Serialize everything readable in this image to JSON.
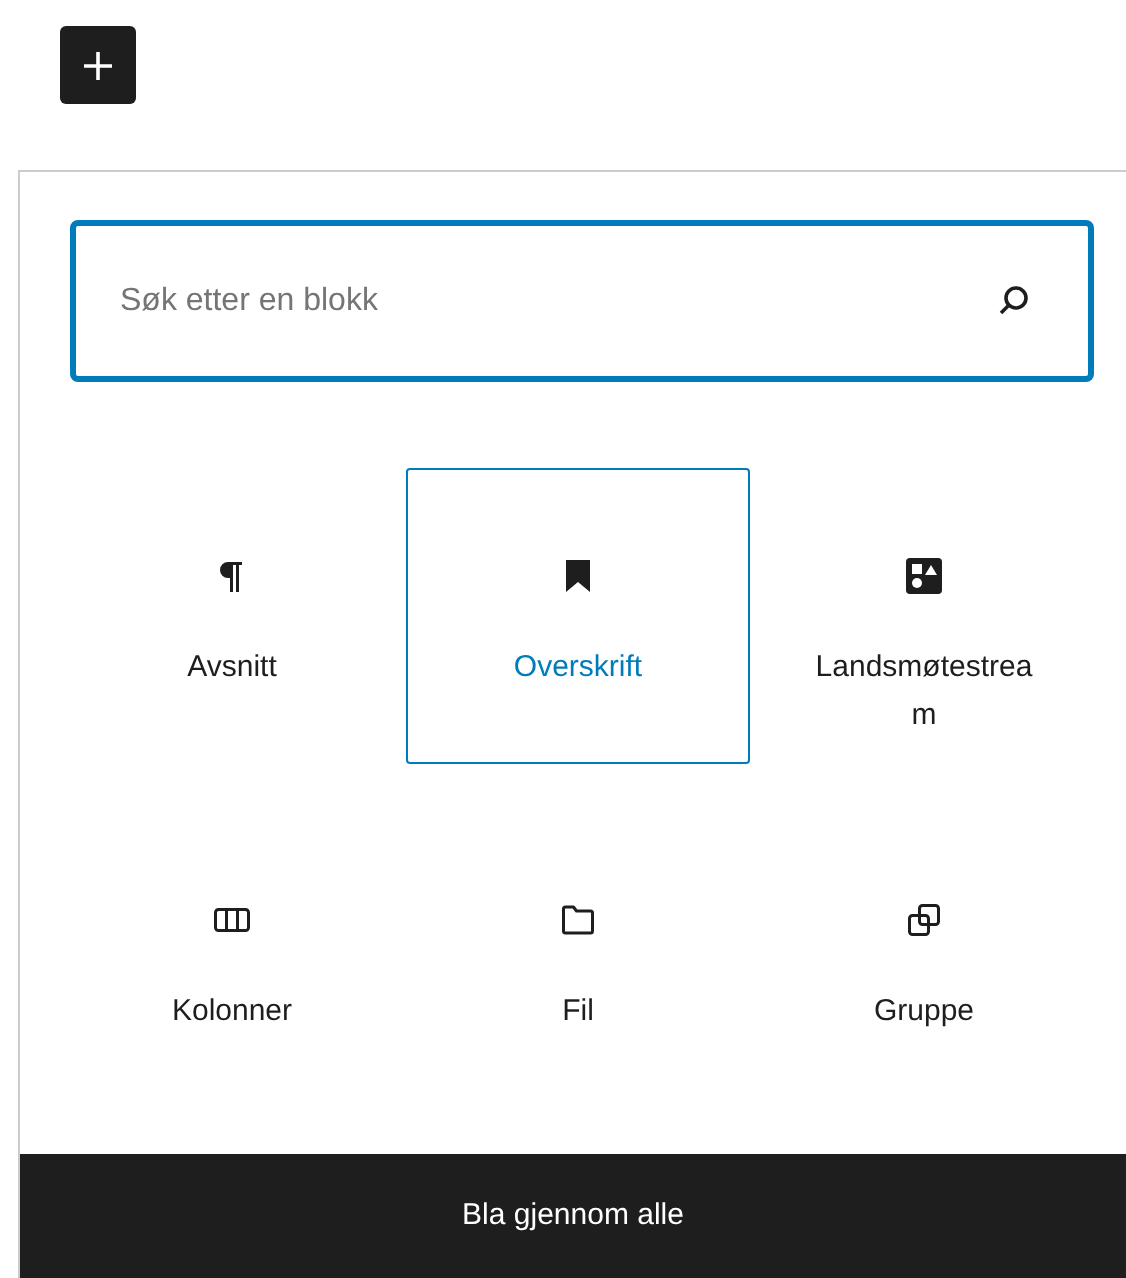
{
  "search": {
    "placeholder": "Søk etter en blokk"
  },
  "blocks": [
    {
      "kind": "paragraph",
      "label": "Avsnitt",
      "selected": false
    },
    {
      "kind": "heading",
      "label": "Overskrift",
      "selected": true
    },
    {
      "kind": "media",
      "label": "Landsmøtestream",
      "selected": false
    },
    {
      "kind": "columns",
      "label": "Kolonner",
      "selected": false
    },
    {
      "kind": "file",
      "label": "Fil",
      "selected": false
    },
    {
      "kind": "group",
      "label": "Gruppe",
      "selected": false
    }
  ],
  "footer": {
    "label": "Bla gjennom alle"
  }
}
